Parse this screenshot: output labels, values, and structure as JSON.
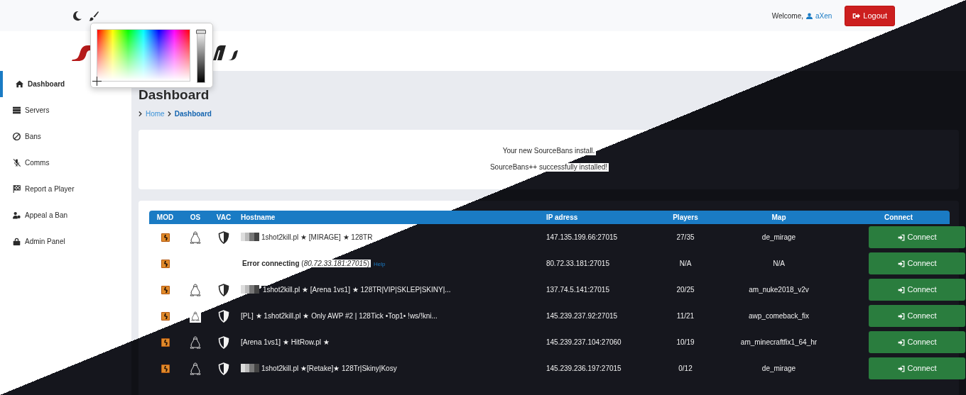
{
  "header": {
    "welcome": "Welcome,",
    "user": "aXen",
    "logout": "Logout"
  },
  "color_picker": {
    "level": 1
  },
  "sidebar": {
    "items": [
      {
        "label": "Dashboard",
        "selected": true
      },
      {
        "label": "Servers",
        "selected": false
      },
      {
        "label": "Bans",
        "selected": false
      },
      {
        "label": "Comms",
        "selected": false
      },
      {
        "label": "Report a Player",
        "selected": false
      },
      {
        "label": "Appeal a Ban",
        "selected": false
      },
      {
        "label": "Admin Panel",
        "selected": false
      }
    ]
  },
  "page_title": "Dashboard",
  "breadcrumb": [
    {
      "label": "Home",
      "selected": false
    },
    {
      "label": "Dashboard",
      "selected": true
    }
  ],
  "notice": [
    "Your new SourceBans install.",
    "SourceBans++ successfully installed!"
  ],
  "table": {
    "columns": [
      "MOD",
      "OS",
      "VAC",
      "Hostname",
      "IP adress",
      "Players",
      "Map",
      "Connect"
    ],
    "rows": [
      {
        "kind": "online",
        "flag": true,
        "hostname": "1shot2kill.pl ★ [MIRAGE] ★ 128TR",
        "ip": "147.135.199.66:27015",
        "players": "27/35",
        "map": "de_mirage",
        "button": "Connect"
      },
      {
        "kind": "error",
        "hostname": "**Error connecting** (*80.72.33.181:27015*)",
        "help": "Help",
        "ip": "80.72.33.181:27015",
        "players": "N/A",
        "map": "N/A",
        "button": "Connect"
      },
      {
        "kind": "online",
        "flag": true,
        "hostname": "1shot2kill.pl ★ [Arena 1vs1] ★ 128TR|VIP|SKLEP|SKINY|...",
        "ip": "137.74.5.141:27015",
        "players": "20/25",
        "map": "am_nuke2018_v2v",
        "button": "Connect"
      },
      {
        "kind": "online",
        "flag": false,
        "hostname": "[PL] ★ 1shot2kill.pl ★ Only AWP #2 | 128Tick •Top1• !ws/!kni...",
        "ip": "145.239.237.92:27015",
        "players": "11/21",
        "map": "awp_comeback_fix",
        "button": "Connect"
      },
      {
        "kind": "online",
        "flag": false,
        "hostname": "[Arena 1vs1] ★ HitRow.pl ★",
        "ip": "145.239.237.104:27060",
        "players": "10/19",
        "map": "am_minecraftfix1_64_hr",
        "button": "Connect"
      },
      {
        "kind": "online",
        "flag": true,
        "hostname": "1shot2kill.pl ★[Retake]★ 128Tr|Skiny|Kosy",
        "ip": "145.239.236.197:27015",
        "players": "0/12",
        "map": "de_mirage",
        "button": "Connect"
      }
    ]
  }
}
